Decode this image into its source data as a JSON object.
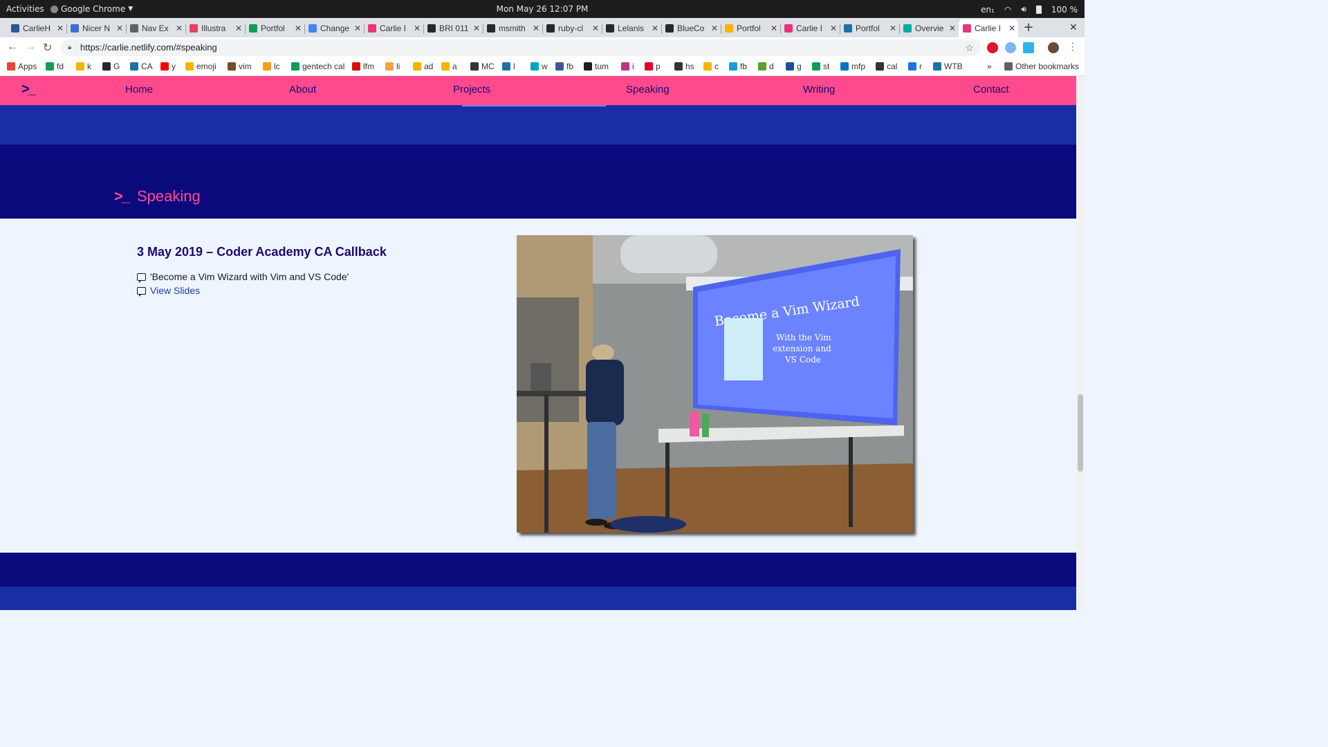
{
  "system_bar": {
    "activities": "Activities",
    "app_name": "Google Chrome",
    "clock": "Mon May 26  12:07 PM",
    "lang": "en₁",
    "battery": "100 %"
  },
  "tabs": [
    {
      "label": "CarlieH",
      "color": "#2b5797"
    },
    {
      "label": "Nicer N",
      "color": "#3b6fd4"
    },
    {
      "label": "Nav Ex",
      "color": "#5f6368"
    },
    {
      "label": "Illustra",
      "color": "#e2445c"
    },
    {
      "label": "Portfol",
      "color": "#0f9d58"
    },
    {
      "label": "Change",
      "color": "#4285f4"
    },
    {
      "label": "Carlie I",
      "color": "#e8347a"
    },
    {
      "label": "BRI 011",
      "color": "#24292e"
    },
    {
      "label": "msmith",
      "color": "#24292e"
    },
    {
      "label": "ruby-cl",
      "color": "#24292e"
    },
    {
      "label": "Lelanis",
      "color": "#24292e"
    },
    {
      "label": "BlueCo",
      "color": "#24292e"
    },
    {
      "label": "Portfol",
      "color": "#f4b400"
    },
    {
      "label": "Carlie I",
      "color": "#e8347a"
    },
    {
      "label": "Portfol",
      "color": "#1a73a8"
    },
    {
      "label": "Overvie",
      "color": "#00ad9f"
    },
    {
      "label": "Carlie I",
      "color": "#e8347a"
    }
  ],
  "new_tab": "+",
  "close_window": "✕",
  "url": "https://carlie.netlify.com/#speaking",
  "bookmarks": [
    {
      "label": "Apps",
      "color": "#ea4335"
    },
    {
      "label": "fd",
      "color": "#0f9d58"
    },
    {
      "label": "k",
      "color": "#f4b400"
    },
    {
      "label": "G",
      "color": "#24292e"
    },
    {
      "label": "CA",
      "color": "#1a73a8"
    },
    {
      "label": "y",
      "color": "#ff0000"
    },
    {
      "label": "emoji",
      "color": "#f4b400"
    },
    {
      "label": "vim",
      "color": "#7a4b2a"
    },
    {
      "label": "lc",
      "color": "#f89f1b"
    },
    {
      "label": "gentech cal",
      "color": "#0f9d58"
    },
    {
      "label": "lfm",
      "color": "#d51007"
    },
    {
      "label": "li",
      "color": "#f4a340"
    },
    {
      "label": "ad",
      "color": "#f4b400"
    },
    {
      "label": "a",
      "color": "#f4b400"
    },
    {
      "label": "MC",
      "color": "#333333"
    },
    {
      "label": "l",
      "color": "#1a73a8"
    },
    {
      "label": "w",
      "color": "#00a4c7"
    },
    {
      "label": "fb",
      "color": "#3b5998"
    },
    {
      "label": "tum",
      "color": "#1d1d1d"
    },
    {
      "label": "i",
      "color": "#c13584"
    },
    {
      "label": "p",
      "color": "#e60023"
    },
    {
      "label": "hs",
      "color": "#333333"
    },
    {
      "label": "c",
      "color": "#f4b400"
    },
    {
      "label": "fb",
      "color": "#1a9bd7"
    },
    {
      "label": "d",
      "color": "#5aa02c"
    },
    {
      "label": "g",
      "color": "#1f4e9c"
    },
    {
      "label": "st",
      "color": "#0f9d58"
    },
    {
      "label": "mfp",
      "color": "#0074c8"
    },
    {
      "label": "cal",
      "color": "#333333"
    },
    {
      "label": "r",
      "color": "#1a73e8"
    },
    {
      "label": "WTB",
      "color": "#1a73a8"
    }
  ],
  "bookmarks_more": "»",
  "other_bookmarks": "Other bookmarks",
  "site_nav": {
    "logo": ">_",
    "links": [
      "Home",
      "About",
      "Projects",
      "Speaking",
      "Writing",
      "Contact"
    ]
  },
  "section": {
    "prompt": ">_",
    "title": "Speaking"
  },
  "talk": {
    "date_title": "3 May 2019 – Coder Academy CA Callback",
    "talk_name": "'Become a Vim Wizard with Vim and VS Code'",
    "slides_link": "View Slides"
  },
  "photo_slide": {
    "title": "Become a Vim Wizard",
    "subtitle_1": "With the Vim",
    "subtitle_2": "extension and",
    "subtitle_3": "VS Code"
  },
  "colors": {
    "nav": "#ff4a8d",
    "navy": "#0a0a7d",
    "blue": "#1a2ea3",
    "accent": "#ff4a8d",
    "text": "#1b0a73"
  }
}
